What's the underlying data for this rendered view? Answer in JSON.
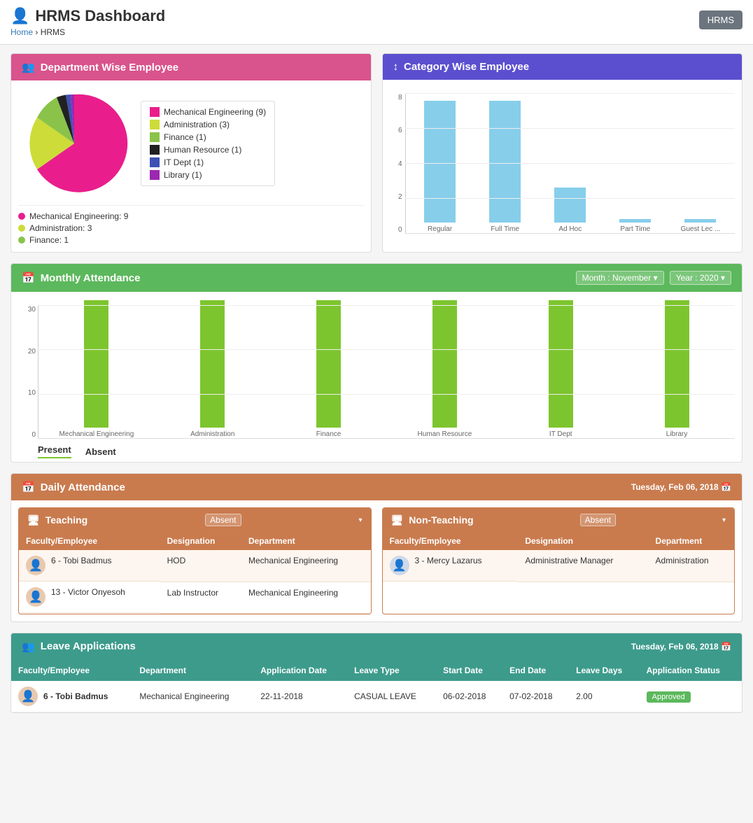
{
  "page": {
    "title": "HRMS Dashboard",
    "title_icon": "👤",
    "breadcrumb_home": "Home",
    "breadcrumb_current": "HRMS",
    "hrms_button": "HRMS"
  },
  "department_wise": {
    "title": "Department Wise Employee",
    "title_icon": "👥",
    "legend": [
      {
        "label": "Mechanical Engineering (9)",
        "color": "#e91e8c"
      },
      {
        "label": "Administration (3)",
        "color": "#cddc39"
      },
      {
        "label": "Finance (1)",
        "color": "#8bc34a"
      },
      {
        "label": "Human Resource (1)",
        "color": "#212121"
      },
      {
        "label": "IT Dept (1)",
        "color": "#3f51b5"
      },
      {
        "label": "Library (1)",
        "color": "#9c27b0"
      }
    ],
    "bottom_legend": [
      {
        "label": "Mechanical Engineering: 9",
        "color": "#e91e8c"
      },
      {
        "label": "Administration: 3",
        "color": "#cddc39"
      },
      {
        "label": "Finance: 1",
        "color": "#8bc34a"
      }
    ]
  },
  "category_wise": {
    "title": "Category Wise Employee",
    "title_icon": "↕",
    "bars": [
      {
        "label": "Regular",
        "value": 7,
        "height_pct": 87
      },
      {
        "label": "Full Time",
        "value": 7,
        "height_pct": 87
      },
      {
        "label": "Ad Hoc",
        "value": 2,
        "height_pct": 25
      },
      {
        "label": "Part Time",
        "value": 0.2,
        "height_pct": 3
      },
      {
        "label": "Guest Lec ...",
        "value": 0.2,
        "height_pct": 3
      }
    ],
    "y_labels": [
      "0",
      "2",
      "4",
      "6",
      "8"
    ]
  },
  "monthly_attendance": {
    "title": "Monthly Attendance",
    "title_icon": "📅",
    "month_label": "Month : November",
    "year_label": "Year : 2020",
    "bars": [
      {
        "label": "Mechanical Engineering",
        "value": 30,
        "height_pct": 97
      },
      {
        "label": "Administration",
        "value": 30,
        "height_pct": 97
      },
      {
        "label": "Finance",
        "value": 30,
        "height_pct": 97
      },
      {
        "label": "Human Resource",
        "value": 30,
        "height_pct": 97
      },
      {
        "label": "IT Dept",
        "value": 30,
        "height_pct": 97
      },
      {
        "label": "Library",
        "value": 30,
        "height_pct": 97
      }
    ],
    "y_labels": [
      "0",
      "10",
      "20",
      "30"
    ],
    "legend_present": "Present",
    "legend_absent": "Absent"
  },
  "daily_attendance": {
    "title": "Daily Attendance",
    "title_icon": "📅",
    "date": "Tuesday, Feb 06, 2018",
    "teaching": {
      "title": "Teaching",
      "absent_label": "Absent",
      "columns": [
        "Faculty/Employee",
        "Designation",
        "Department"
      ],
      "rows": [
        {
          "id": "6",
          "name": "Tobi Badmus",
          "designation": "HOD",
          "department": "Mechanical Engineering"
        },
        {
          "id": "13",
          "name": "Victor Onyesoh",
          "designation": "Lab Instructor",
          "department": "Mechanical Engineering"
        }
      ]
    },
    "non_teaching": {
      "title": "Non-Teaching",
      "absent_label": "Absent",
      "columns": [
        "Faculty/Employee",
        "Designation",
        "Department"
      ],
      "rows": [
        {
          "id": "3",
          "name": "Mercy Lazarus",
          "designation": "Administrative Manager",
          "department": "Administration"
        }
      ]
    }
  },
  "leave_applications": {
    "title": "Leave Applications",
    "title_icon": "👥",
    "date": "Tuesday, Feb 06, 2018",
    "columns": [
      "Faculty/Employee",
      "Department",
      "Application Date",
      "Leave Type",
      "Start Date",
      "End Date",
      "Leave Days",
      "Application Status"
    ],
    "rows": [
      {
        "id": "6",
        "name": "Tobi Badmus",
        "department": "Mechanical Engineering",
        "app_date": "22-11-2018",
        "leave_type": "CASUAL LEAVE",
        "start_date": "06-02-2018",
        "end_date": "07-02-2018",
        "leave_days": "2.00",
        "status": "Approved",
        "status_color": "#5cb85c"
      }
    ]
  }
}
